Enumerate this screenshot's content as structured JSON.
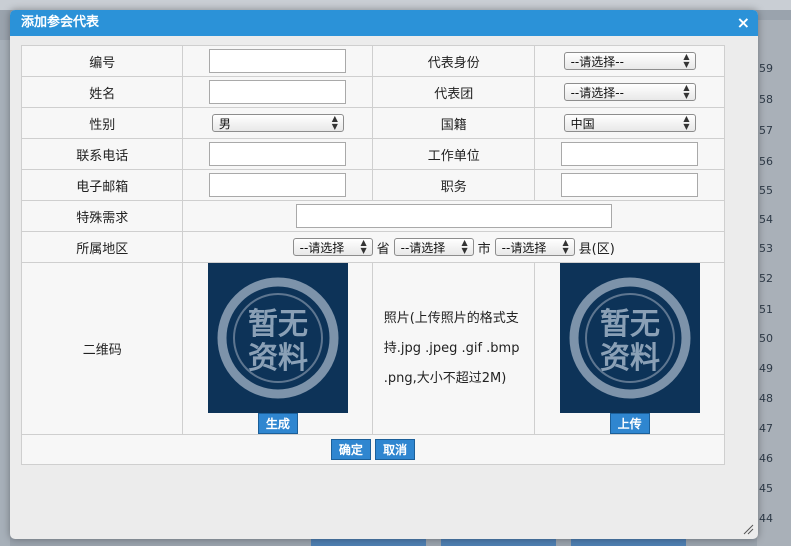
{
  "dialog": {
    "title": "添加参会代表",
    "close_label": "×"
  },
  "form": {
    "number_label": "编号",
    "role_label": "代表身份",
    "role_select": "--请选择--",
    "name_label": "姓名",
    "delegation_label": "代表团",
    "delegation_select": "--请选择--",
    "gender_label": "性别",
    "gender_select": "男",
    "nationality_label": "国籍",
    "nationality_select": "中国",
    "phone_label": "联系电话",
    "employer_label": "工作单位",
    "email_label": "电子邮箱",
    "position_label": "职务",
    "special_label": "特殊需求",
    "region_label": "所属地区",
    "province_select": "--请选择",
    "province_suffix": "省",
    "city_select": "--请选择",
    "city_suffix": "市",
    "county_select": "--请选择",
    "county_suffix": "县(区)",
    "qr_label": "二维码",
    "placeholder_image_text_1": "暂无",
    "placeholder_image_text_2": "资料",
    "generate_button": "生成",
    "photo_note": "照片(上传照片的格式支持.jpg .jpeg .gif .bmp .png,大小不超过2M)",
    "upload_button": "上传",
    "confirm_button": "确定",
    "cancel_button": "取消"
  },
  "background": {
    "row_numbers": [
      "59",
      "58",
      "57",
      "56",
      "55",
      "54",
      "53",
      "52",
      "51",
      "50",
      "49",
      "48",
      "47",
      "46",
      "45",
      "44"
    ]
  }
}
